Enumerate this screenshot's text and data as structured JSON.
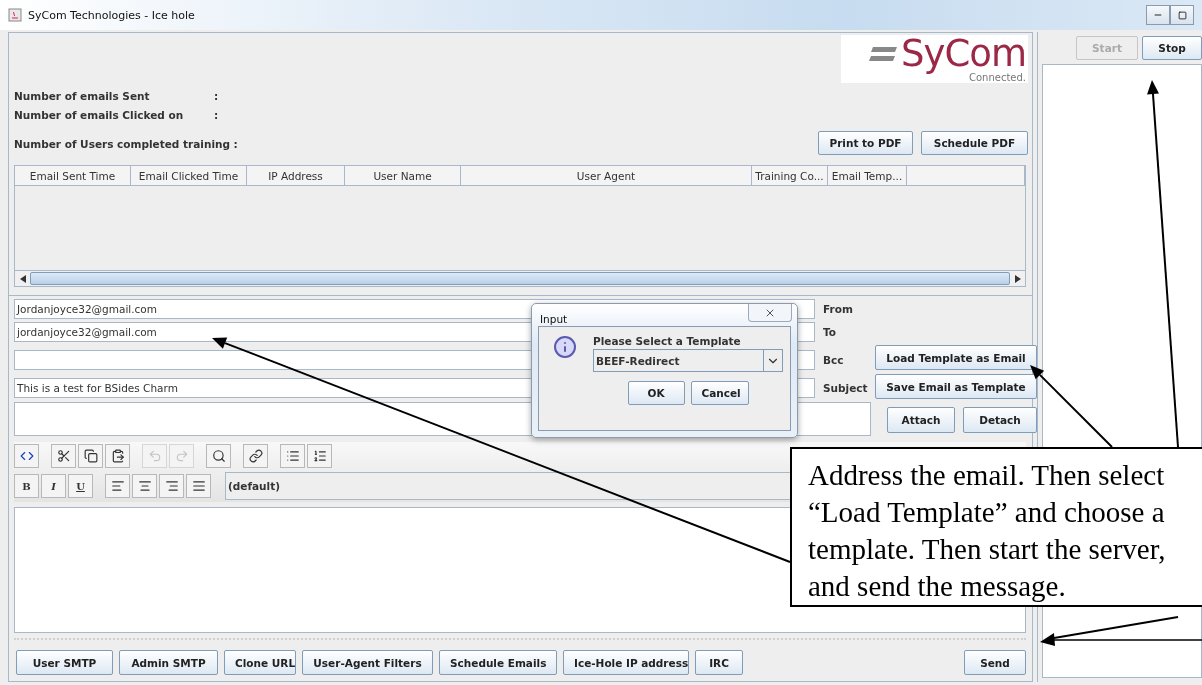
{
  "window": {
    "title": "SyCom Technologies - Ice hole"
  },
  "logo": {
    "text": "SyCom",
    "tagline": "Connected."
  },
  "stats": [
    {
      "label": "Number of emails Sent",
      "separator": ":"
    },
    {
      "label": "Number of emails Clicked on",
      "separator": ":"
    },
    {
      "label": "Number of Users completed training :"
    }
  ],
  "report_buttons": [
    "Print to PDF",
    "Schedule PDF"
  ],
  "table": {
    "columns": [
      "Email Sent Time",
      "Email Clicked Time",
      "IP Address",
      "User Name",
      "User Agent",
      "Training Co...",
      "Email Temp..."
    ]
  },
  "email": {
    "fields": [
      {
        "label": "From",
        "value": "Jordanjoyce32@gmail.com"
      },
      {
        "label": "To",
        "value": "jordanjoyce32@gmail.com"
      },
      {
        "label": "Bcc"
      },
      {
        "label": "Subject",
        "value": "This is a test for BSides Charm"
      }
    ],
    "template_buttons": [
      "Load Template as Email",
      "Save Email as Template"
    ],
    "attach_buttons": [
      "Attach",
      "Detach"
    ]
  },
  "editor": {
    "tools": [
      {
        "disabled": false
      },
      {
        "disabled": false
      },
      {
        "disabled": false
      },
      {
        "disabled": false
      },
      {
        "disabled": true
      },
      {
        "disabled": true
      },
      {
        "disabled": false
      },
      {
        "disabled": false
      },
      {
        "disabled": false
      },
      {
        "disabled": false
      }
    ],
    "format_buttons": [
      "B",
      "I",
      "U"
    ],
    "style": "(default)"
  },
  "bottom_buttons": [
    "User SMTP",
    "Admin SMTP",
    "Clone URL",
    "User-Agent Filters",
    "Schedule Emails",
    "Ice-Hole IP address",
    "IRC"
  ],
  "send_button": "Send",
  "server": {
    "buttons": [
      {
        "label": "Start",
        "disabled": true
      },
      {
        "label": "Stop",
        "disabled": false
      }
    ]
  },
  "dialog": {
    "title": "Input",
    "message": "Please Select a Template",
    "selection": "BEEF-Redirect",
    "buttons": [
      "OK",
      "Cancel"
    ]
  },
  "callout": {
    "text": "Address the email. Then select “Load Template” and choose a template. Then start the server, and send the message."
  }
}
